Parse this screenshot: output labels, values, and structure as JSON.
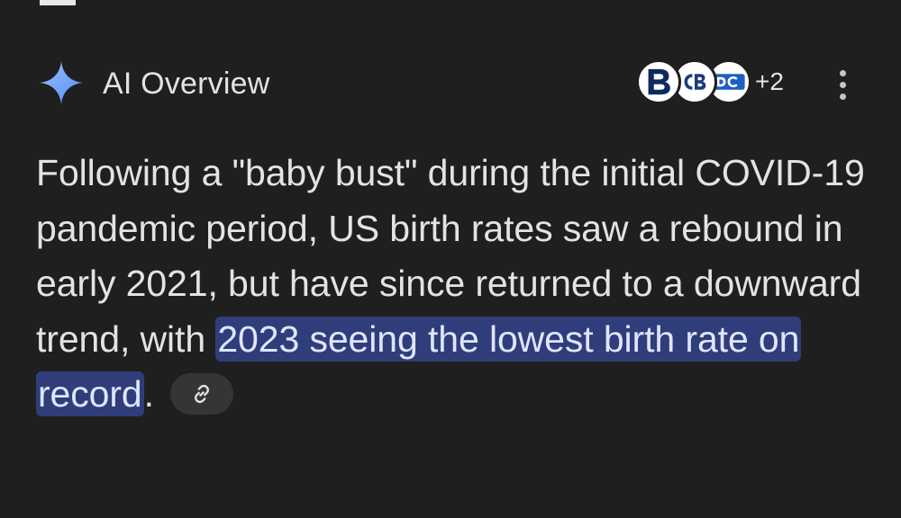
{
  "header": {
    "title": "AI Overview",
    "source_count": "+2",
    "sources": [
      {
        "name": "source-1",
        "initials": "B"
      },
      {
        "name": "source-2",
        "initials": "CB"
      },
      {
        "name": "source-3",
        "initials": "DC"
      }
    ],
    "more_icon": "more-vert-icon",
    "spark_icon": "sparkle-icon"
  },
  "overview": {
    "text_before": "Following a \"baby bust\" during the initial COVID-19 pandemic period, US birth rates saw a rebound in early 2021, but have since returned to a downward trend, with ",
    "highlight": "2023 seeing the lowest birth rate on record",
    "text_after": ".",
    "link_icon": "link-icon"
  },
  "colors": {
    "background": "#1f1f1f",
    "text": "#e3e3e3",
    "highlight_bg": "#2f3e7a",
    "spark": "#8ab4f8",
    "chip_bg": "#333537"
  }
}
